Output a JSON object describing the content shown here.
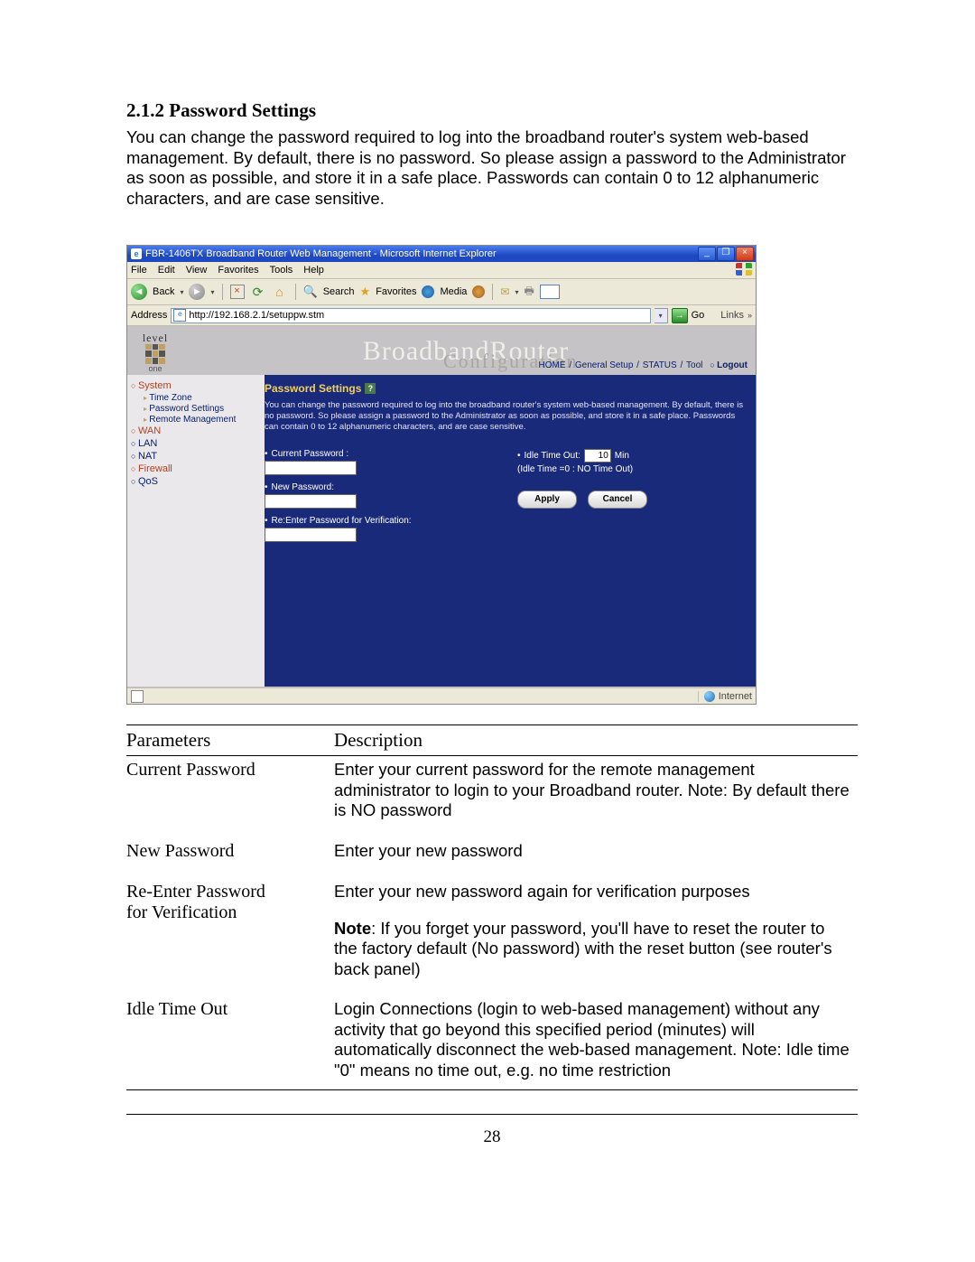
{
  "section": {
    "number": "2.1.2",
    "title": "Password Settings",
    "paragraph": "You can change the password required to log into the broadband router's system web-based management. By default, there is no password. So please assign a password to the Administrator as soon as possible, and store it in a safe place. Passwords can contain 0 to 12 alphanumeric characters, and are case sensitive."
  },
  "ie": {
    "title": "FBR-1406TX Broadband Router Web Management - Microsoft Internet Explorer",
    "menu": [
      "File",
      "Edit",
      "View",
      "Favorites",
      "Tools",
      "Help"
    ],
    "toolbar": {
      "back": "Back",
      "search": "Search",
      "favorites": "Favorites",
      "media": "Media"
    },
    "address_label": "Address",
    "address_url": "http://192.168.2.1/setuppw.stm",
    "go": "Go",
    "links": "Links",
    "status_zone": "Internet"
  },
  "router": {
    "logo_top": "level",
    "logo_bottom": "one",
    "banner_title": "BroadbandRouter",
    "banner_subtitle": "Configuration",
    "top_links": {
      "home": "HOME",
      "gs": "General Setup",
      "status": "STATUS",
      "tool": "Tool",
      "logout": "Logout"
    },
    "nav": {
      "system": "System",
      "time_zone": "Time Zone",
      "password_settings": "Password Settings",
      "remote_management": "Remote Management",
      "wan": "WAN",
      "lan": "LAN",
      "nat": "NAT",
      "firewall": "Firewall",
      "qos": "QoS"
    },
    "content": {
      "heading": "Password Settings",
      "help": "?",
      "desc": "You can change the password required to log into the broadband router's system web-based management. By default, there is no password. So please assign a password to the Administrator as soon as possible, and store it in a safe place. Passwords can contain 0 to 12 alphanumeric characters, and are case sensitive.",
      "current_pw": "Current Password :",
      "new_pw": "New Password:",
      "reenter_pw": "Re:Enter Password for Verification:",
      "idle_label": "Idle Time Out:",
      "idle_value": "10",
      "idle_unit": "Min",
      "idle_note": "(Idle Time =0 : NO Time Out)",
      "apply": "Apply",
      "cancel": "Cancel"
    }
  },
  "table": {
    "header_param": "Parameters",
    "header_desc": "Description",
    "rows": [
      {
        "name": "Current Password",
        "desc": "Enter your current password for the remote management administrator to login to your Broadband router.\nNote: By default there is NO password"
      },
      {
        "name": "New Password",
        "desc": "Enter your new password"
      },
      {
        "name": "Re-Enter Password\nfor Verification",
        "desc": "Enter your new password again for verification purposes",
        "note_html": "<b>Note</b>: If you forget your password, you'll have to reset the router to the factory default (No password) with the reset button (see router's back panel)"
      },
      {
        "name": "Idle Time Out",
        "desc": "Login Connections (login to web-based management) without any activity that go beyond this specified period (minutes) will automatically disconnect the web-based management. Note: Idle time \"0\" means no time out, e.g. no time restriction"
      }
    ]
  },
  "page_number": "28"
}
